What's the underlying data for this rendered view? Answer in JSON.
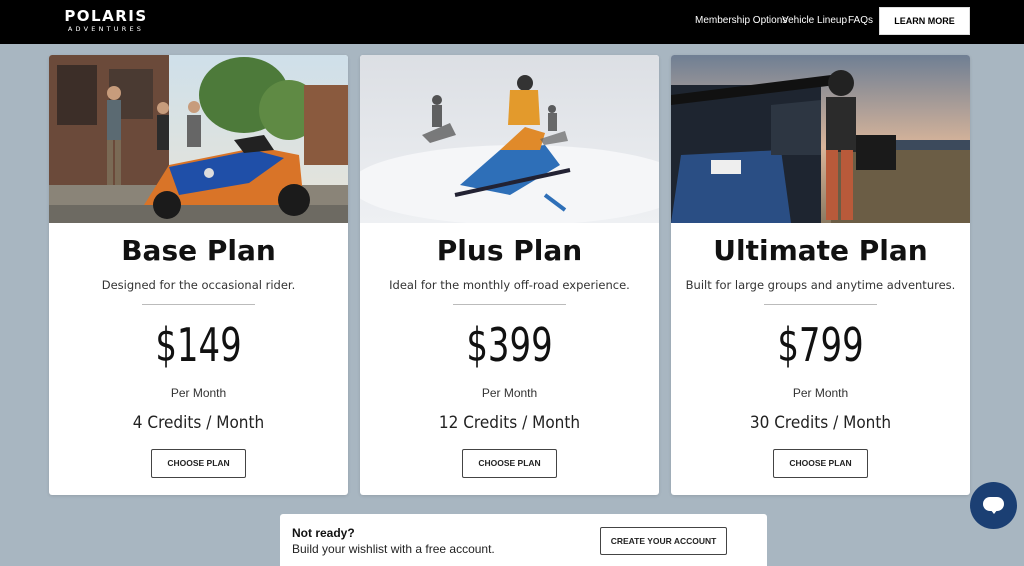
{
  "brand": {
    "name": "POLARIS",
    "tagline": "ADVENTURES"
  },
  "nav": {
    "items": [
      {
        "label": "Membership Options"
      },
      {
        "label": "Vehicle Lineup"
      },
      {
        "label": "FAQs"
      }
    ],
    "cta_label": "LEARN MORE"
  },
  "plans": [
    {
      "name": "Base Plan",
      "description": "Designed for the occasional rider.",
      "price": "$149",
      "period": "Per Month",
      "credits": "4 Credits / Month",
      "button_label": "CHOOSE PLAN"
    },
    {
      "name": "Plus Plan",
      "description": "Ideal for the monthly off-road experience.",
      "price": "$399",
      "period": "Per Month",
      "credits": "12 Credits / Month",
      "button_label": "CHOOSE PLAN"
    },
    {
      "name": "Ultimate Plan",
      "description": "Built for large groups and anytime adventures.",
      "price": "$799",
      "period": "Per Month",
      "credits": "30 Credits / Month",
      "button_label": "CHOOSE PLAN"
    }
  ],
  "banner": {
    "title": "Not ready?",
    "subtitle": "Build your wishlist with a free account.",
    "button_label": "CREATE YOUR ACCOUNT"
  },
  "colors": {
    "page_background": "#a8b6c1",
    "header_background": "#000000",
    "chat_button": "#1b3f73"
  },
  "icons": {
    "chat": "chat-bubble-icon"
  }
}
